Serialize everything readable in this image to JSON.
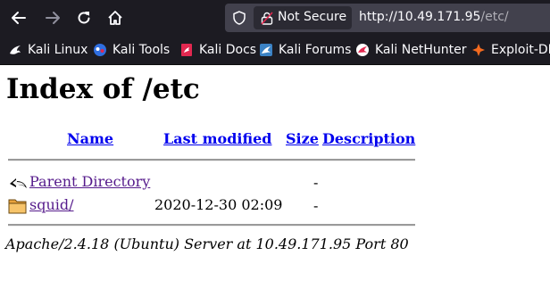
{
  "browser": {
    "security_label": "Not Secure",
    "url_host": "http://10.49.171.95",
    "url_path": "/etc/"
  },
  "bookmarks": [
    {
      "label": "Kali Linux",
      "icon": "kali-dragon-icon"
    },
    {
      "label": "Kali Tools",
      "icon": "kali-tools-icon"
    },
    {
      "label": "Kali Docs",
      "icon": "kali-docs-icon"
    },
    {
      "label": "Kali Forums",
      "icon": "kali-forums-icon"
    },
    {
      "label": "Kali NetHunter",
      "icon": "kali-nethunter-icon"
    },
    {
      "label": "Exploit-DB",
      "icon": "exploit-db-icon"
    }
  ],
  "page": {
    "heading": "Index of /etc",
    "columns": {
      "name": "Name",
      "last_modified": "Last modified",
      "size": "Size",
      "description": "Description"
    },
    "rows": [
      {
        "name": "Parent Directory",
        "modified": "",
        "size": "-",
        "icon": "back-arrow-icon"
      },
      {
        "name": "squid/",
        "modified": "2020-12-30 02:09",
        "size": "-",
        "icon": "folder-icon"
      }
    ],
    "footer": "Apache/2.4.18 (Ubuntu) Server at 10.49.171.95 Port 80"
  },
  "colors": {
    "toolbar_bg": "#1c1b22",
    "urlbar_bg": "#42414d",
    "link": "#0000ee",
    "visited_link": "#551a8b"
  }
}
